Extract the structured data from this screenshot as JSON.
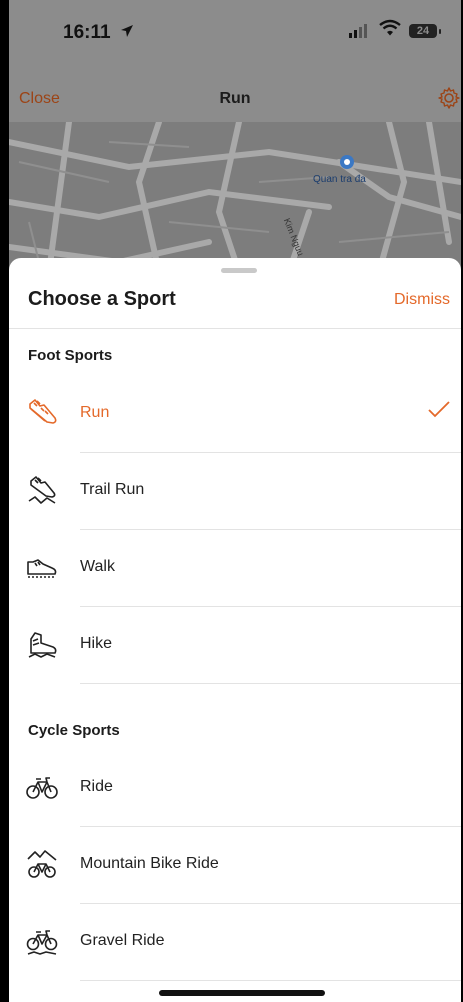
{
  "status_bar": {
    "time": "16:11",
    "battery": "24"
  },
  "nav": {
    "close": "Close",
    "title": "Run"
  },
  "map": {
    "poi": "Quan tra đa",
    "street": "Kim Nguu"
  },
  "sheet": {
    "title": "Choose a Sport",
    "dismiss": "Dismiss",
    "sections": [
      {
        "title": "Foot Sports",
        "items": [
          "Run",
          "Trail Run",
          "Walk",
          "Hike"
        ]
      },
      {
        "title": "Cycle Sports",
        "items": [
          "Ride",
          "Mountain Bike Ride",
          "Gravel Ride"
        ]
      }
    ],
    "selected": "Run"
  },
  "colors": {
    "accent": "#e4692a",
    "dim_overlay": "#8c8c8c"
  }
}
